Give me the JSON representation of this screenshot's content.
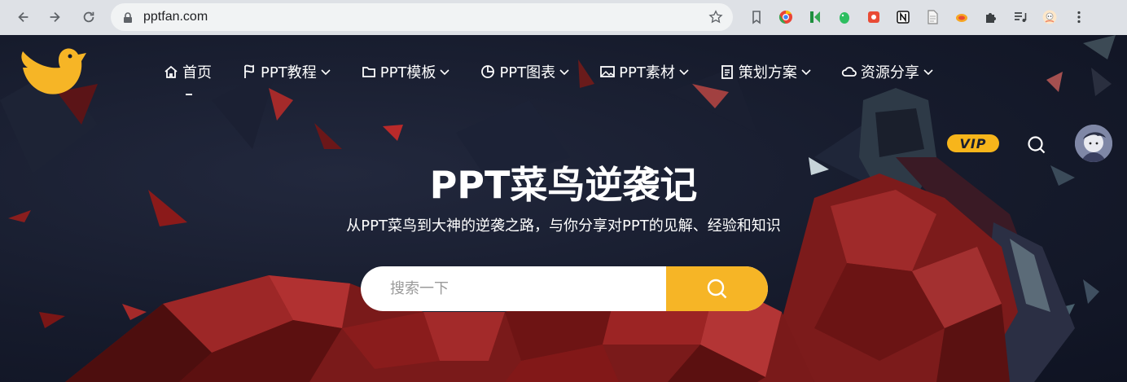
{
  "browser": {
    "url": "pptfan.com",
    "icons": [
      "back-icon",
      "forward-icon",
      "reload-icon",
      "lock-icon",
      "star-icon",
      "bookmark-icon",
      "chrome-ext-icon",
      "green-k-ext-icon",
      "evernote-icon",
      "red-ext-icon",
      "notion-icon",
      "document-icon",
      "orange-ext-icon",
      "puzzle-icon",
      "playlist-icon",
      "profile-icon",
      "menu-icon"
    ]
  },
  "site": {
    "nav": [
      {
        "label": "首页",
        "icon": "home-icon",
        "dropdown": false
      },
      {
        "label": "PPT教程",
        "icon": "flag-icon",
        "dropdown": true
      },
      {
        "label": "PPT模板",
        "icon": "folder-icon",
        "dropdown": true
      },
      {
        "label": "PPT图表",
        "icon": "pie-chart-icon",
        "dropdown": true
      },
      {
        "label": "PPT素材",
        "icon": "image-icon",
        "dropdown": true
      },
      {
        "label": "策划方案",
        "icon": "clipboard-icon",
        "dropdown": true
      },
      {
        "label": "资源分享",
        "icon": "cloud-icon",
        "dropdown": true
      }
    ],
    "vip_label": "VIP",
    "hero": {
      "title": "PPT菜鸟逆袭记",
      "subtitle": "从PPT菜鸟到大神的逆袭之路，与你分享对PPT的见解、经验和知识"
    },
    "search": {
      "placeholder": "搜索一下"
    }
  },
  "colors": {
    "accent": "#f6b526",
    "background": "#141a2b",
    "hero_red": "#8c1d1d"
  }
}
